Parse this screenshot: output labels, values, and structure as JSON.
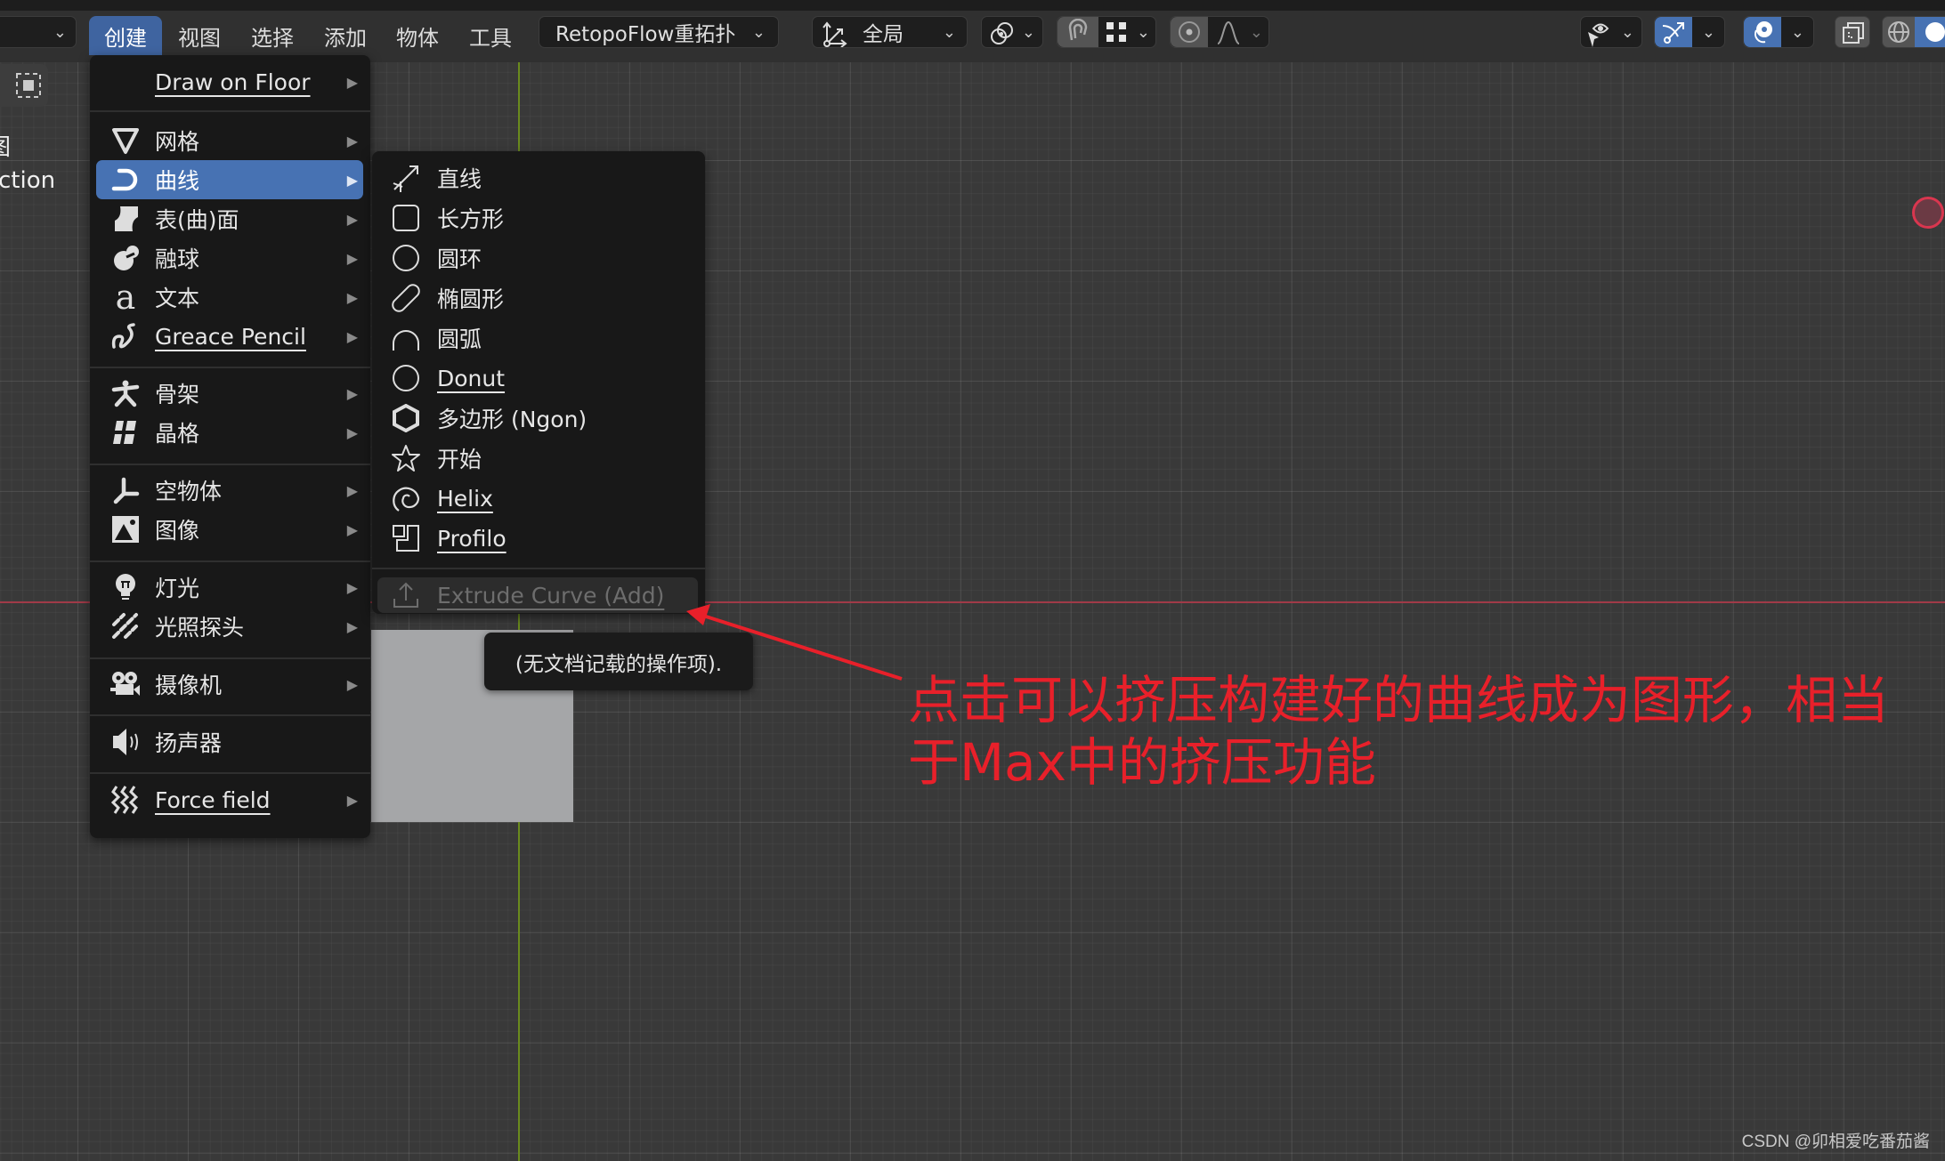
{
  "header": {
    "menu_tabs": [
      {
        "label": "创建",
        "active": true
      },
      {
        "label": "视图",
        "active": false
      },
      {
        "label": "选择",
        "active": false
      },
      {
        "label": "添加",
        "active": false
      },
      {
        "label": "物体",
        "active": false
      },
      {
        "label": "工具",
        "active": false
      }
    ],
    "addon_dropdown": "RetopoFlow重拓扑",
    "transform_orientation": "全局",
    "icons": {
      "pivot": "pivot-point-icon",
      "snap": "snap-magnet-icon",
      "snap_target": "snap-increment-icon",
      "proportional": "proportional-edit-icon",
      "falloff": "falloff-curve-icon",
      "visibility": "selectability-visibility-icon",
      "gizmo": "gizmo-icon",
      "overlays": "overlays-icon",
      "xray": "xray-toggle-icon",
      "shading_wire": "wireframe-shading-icon",
      "shading_solid": "solid-shading-icon"
    }
  },
  "sidebar": {
    "partial_labels": [
      "图",
      "ction"
    ]
  },
  "add_menu": {
    "items": [
      {
        "label": "Draw on Floor",
        "icon": "none",
        "submenu": true,
        "underline": "D"
      },
      {
        "label": "网格",
        "icon": "mesh-icon",
        "submenu": true
      },
      {
        "label": "曲线",
        "icon": "curve-icon",
        "submenu": true,
        "highlighted": true
      },
      {
        "label": "表(曲)面",
        "icon": "surface-icon",
        "submenu": true
      },
      {
        "label": "融球",
        "icon": "metaball-icon",
        "submenu": true
      },
      {
        "label": "文本",
        "icon": "text-icon",
        "submenu": true
      },
      {
        "label": "Greace Pencil",
        "icon": "grease-pencil-icon",
        "submenu": true,
        "underline": "G"
      },
      {
        "label": "骨架",
        "icon": "armature-icon",
        "submenu": true
      },
      {
        "label": "晶格",
        "icon": "lattice-icon",
        "submenu": true
      },
      {
        "label": "空物体",
        "icon": "empty-icon",
        "submenu": true
      },
      {
        "label": "图像",
        "icon": "image-icon",
        "submenu": true
      },
      {
        "label": "灯光",
        "icon": "light-icon",
        "submenu": true
      },
      {
        "label": "光照探头",
        "icon": "light-probe-icon",
        "submenu": true
      },
      {
        "label": "摄像机",
        "icon": "camera-icon",
        "submenu": true
      },
      {
        "label": "扬声器",
        "icon": "speaker-icon",
        "submenu": false
      },
      {
        "label": "Force field",
        "icon": "force-field-icon",
        "submenu": true,
        "underline": "F"
      }
    ]
  },
  "curve_submenu": {
    "items": [
      {
        "label": "直线",
        "icon": "line-curve-icon"
      },
      {
        "label": "长方形",
        "icon": "rectangle-icon"
      },
      {
        "label": "圆环",
        "icon": "circle-icon"
      },
      {
        "label": "椭圆形",
        "icon": "ellipse-icon"
      },
      {
        "label": "圆弧",
        "icon": "arc-icon"
      },
      {
        "label": "Donut",
        "icon": "donut-icon",
        "underline": "D"
      },
      {
        "label": "多边形 (Ngon)",
        "icon": "ngon-icon"
      },
      {
        "label": "开始",
        "icon": "star-icon"
      },
      {
        "label": "Helix",
        "icon": "helix-icon",
        "underline": "H"
      },
      {
        "label": "Profilo",
        "icon": "profile-icon",
        "underline": "P"
      }
    ],
    "extra_item": {
      "label": "Extrude Curve (Add)",
      "icon": "extrude-icon",
      "disabled": true,
      "underline": "E"
    }
  },
  "tooltip": {
    "text": "(无文档记载的操作项)."
  },
  "annotation": {
    "text": "点击可以挤压构建好的曲线成为图形，相当于Max中的挤压功能",
    "color": "#e8202a"
  },
  "watermark": {
    "text": "CSDN @卯相爱吃番茄酱"
  },
  "colors": {
    "accent": "#4772b3",
    "menu_bg": "#181818",
    "axis_x": "#a03a48",
    "axis_y": "#6a8a1e",
    "annotation": "#e8202a"
  }
}
